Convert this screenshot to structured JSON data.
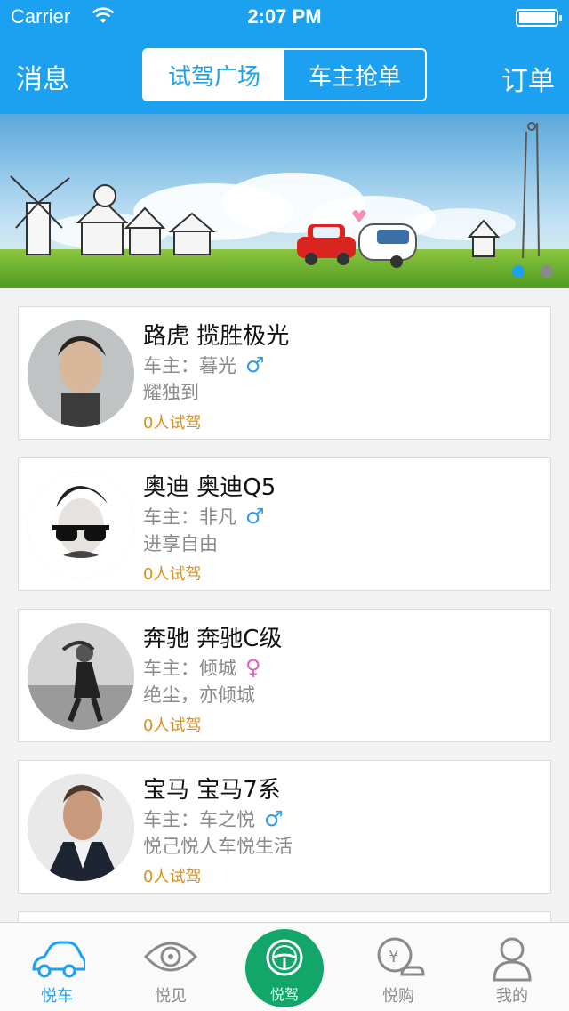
{
  "status_bar": {
    "carrier": "Carrier",
    "time": "2:07 PM"
  },
  "nav": {
    "left": "消息",
    "right": "订单",
    "segments": [
      {
        "label": "试驾广场",
        "active": true
      },
      {
        "label": "车主抢单",
        "active": false
      }
    ]
  },
  "banner": {
    "pages": 2,
    "current": 1
  },
  "cards": [
    {
      "title": "路虎 揽胜极光",
      "owner": "车主：暮光",
      "gender": "♂",
      "gender_type": "male",
      "slogan": "耀独到",
      "count": "0人试驾"
    },
    {
      "title": "奥迪 奥迪Q5",
      "owner": "车主：非凡",
      "gender": "♂",
      "gender_type": "male",
      "slogan": "进享自由",
      "count": "0人试驾"
    },
    {
      "title": "奔驰 奔驰C级",
      "owner": "车主：倾城",
      "gender": "♀",
      "gender_type": "female",
      "slogan": "绝尘，亦倾城",
      "count": "0人试驾"
    },
    {
      "title": "宝马 宝马7系",
      "owner": "车主：车之悦",
      "gender": "♂",
      "gender_type": "male",
      "slogan": "悦己悦人车悦生活",
      "count": "0人试驾"
    }
  ],
  "tabs": [
    {
      "label": "悦车",
      "icon": "car-icon",
      "active": true
    },
    {
      "label": "悦见",
      "icon": "eye-icon",
      "active": false
    },
    {
      "label": "悦驾",
      "icon": "steering-wheel-icon",
      "active": false
    },
    {
      "label": "悦购",
      "icon": "shopping-icon",
      "active": false
    },
    {
      "label": "我的",
      "icon": "user-icon",
      "active": false
    }
  ],
  "colors": {
    "primary": "#1ba1f0",
    "accent_green": "#12a66a",
    "count_orange": "#d8901a",
    "male_blue": "#2f9de8",
    "female_pink": "#e561b9"
  }
}
